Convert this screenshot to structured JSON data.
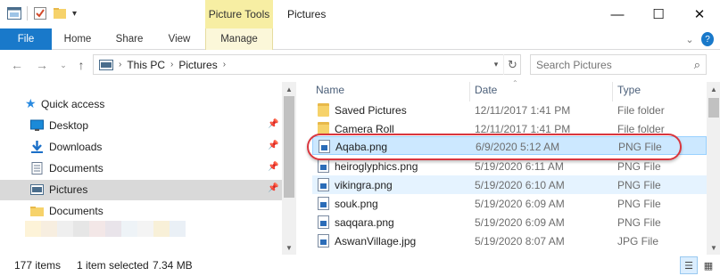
{
  "window": {
    "title": "Pictures",
    "contextual_tab_group": "Picture Tools",
    "minimize": "—",
    "maximize": "☐",
    "close": "✕"
  },
  "ribbon": {
    "tabs": [
      {
        "label": "File"
      },
      {
        "label": "Home"
      },
      {
        "label": "Share"
      },
      {
        "label": "View"
      },
      {
        "label": "Manage"
      }
    ],
    "collapse_glyph": "⌄",
    "help_glyph": "?"
  },
  "address": {
    "crumbs": [
      "This PC",
      "Pictures"
    ],
    "search_placeholder": "Search Pictures"
  },
  "nav": {
    "quick_access": "Quick access",
    "items": [
      {
        "label": "Desktop"
      },
      {
        "label": "Downloads"
      },
      {
        "label": "Documents"
      },
      {
        "label": "Pictures"
      },
      {
        "label": "Documents"
      }
    ]
  },
  "files": {
    "columns": [
      "Name",
      "Date",
      "Type"
    ],
    "rows": [
      {
        "name": "Saved Pictures",
        "date": "12/11/2017 1:41 PM",
        "type": "File folder",
        "icon": "folder-icon"
      },
      {
        "name": "Camera Roll",
        "date": "12/11/2017 1:41 PM",
        "type": "File folder",
        "icon": "folder-icon"
      },
      {
        "name": "Aqaba.png",
        "date": "6/9/2020 5:12 AM",
        "type": "PNG File",
        "icon": "image-file-icon"
      },
      {
        "name": "heiroglyphics.png",
        "date": "5/19/2020 6:11 AM",
        "type": "PNG File",
        "icon": "image-file-icon"
      },
      {
        "name": "vikingra.png",
        "date": "5/19/2020 6:10 AM",
        "type": "PNG File",
        "icon": "image-file-icon"
      },
      {
        "name": "souk.png",
        "date": "5/19/2020 6:09 AM",
        "type": "PNG File",
        "icon": "image-file-icon"
      },
      {
        "name": "saqqara.png",
        "date": "5/19/2020 6:09 AM",
        "type": "PNG File",
        "icon": "image-file-icon"
      },
      {
        "name": "AswanVillage.jpg",
        "date": "5/19/2020 8:07 AM",
        "type": "JPG File",
        "icon": "image-file-icon"
      }
    ]
  },
  "status": {
    "item_count": "177 items",
    "selection": "1 item selected",
    "size": "7.34 MB"
  },
  "colors": {
    "accent": "#1979ca",
    "selection": "#cce8ff",
    "annotation_ring": "#d9363e",
    "contextual_tab": "#f7eea3"
  }
}
